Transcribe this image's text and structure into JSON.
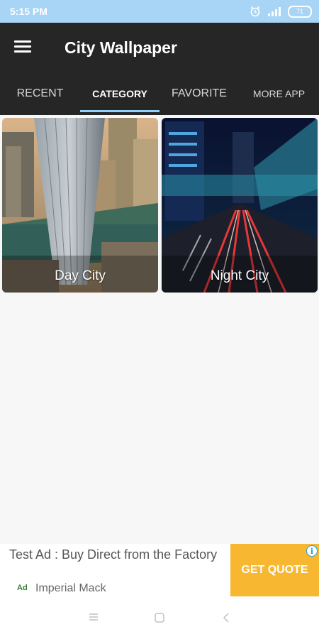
{
  "status_bar": {
    "time": "5:15 PM",
    "battery": "71"
  },
  "toolbar": {
    "title": "City Wallpaper"
  },
  "tabs": [
    {
      "label": "RECENT"
    },
    {
      "label": "CATEGORY",
      "selected": true
    },
    {
      "label": "FAVORITE"
    },
    {
      "label": "MORE APP"
    }
  ],
  "categories": [
    {
      "label": "Day City"
    },
    {
      "label": "Night City"
    }
  ],
  "ad": {
    "headline": "Test Ad : Buy Direct from the Factory",
    "badge": "Ad",
    "advertiser": "Imperial Mack",
    "cta": "GET QUOTE"
  },
  "colors": {
    "accent": "#8ed3f7",
    "toolbar": "#262626",
    "status_bar": "#a8d4f5",
    "cta": "#f7b731"
  }
}
